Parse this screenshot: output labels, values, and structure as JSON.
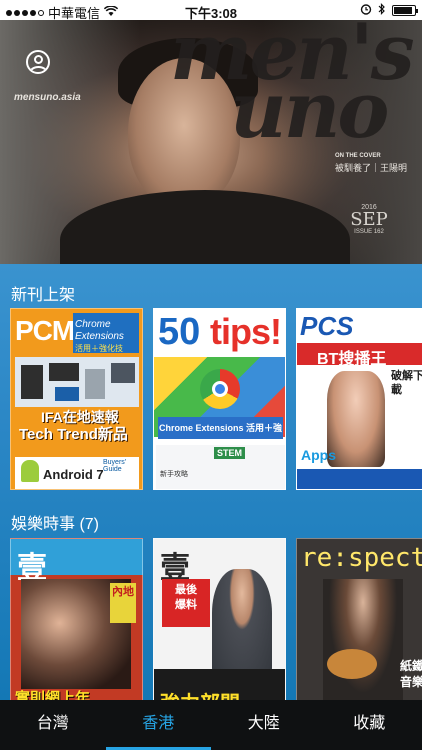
{
  "status_bar": {
    "carrier": "中華電信",
    "time": "下午3:08",
    "battery_level": 0.9
  },
  "hero": {
    "masthead": "men's uno",
    "site": "mensuno.asia",
    "cover_label": "ON THE COVER",
    "cover_name": "被馴養了｜王陽明",
    "issue_year": "2016",
    "issue_month": "SEP",
    "issue_no": "ISSUE 162"
  },
  "sections": [
    {
      "title": "新刊上架",
      "magazines": [
        {
          "name": "PCM",
          "lines": [
            "Chrome",
            "Extensions",
            "活用＋強化技",
            "IFA在地速報",
            "Tech Trend新品",
            "Android 7",
            "Buyers' Guide"
          ]
        },
        {
          "name": "50",
          "lines": [
            "tips!",
            "Chrome Extensions 活用＋強化技",
            "STEM",
            "新手攻略"
          ]
        },
        {
          "name": "PCS",
          "lines": [
            "BT搜播王",
            "破解下載",
            "Apps"
          ]
        }
      ]
    },
    {
      "title": "娛樂時事 (7)",
      "magazines": [
        {
          "name": "壹",
          "lines": [
            "實則網上年",
            "內地"
          ]
        },
        {
          "name": "壹",
          "lines": [
            "最後",
            "爆料",
            "強力部門"
          ]
        },
        {
          "name": "re:spect",
          "lines": [
            "紙鐵",
            "音樂"
          ]
        }
      ]
    }
  ],
  "tabs": [
    "台灣",
    "香港",
    "大陸",
    "收藏"
  ],
  "active_tab": "香港",
  "colors": {
    "accent": "#27a4e3",
    "content_bg_top": "#3a93cf",
    "content_bg_bottom": "#1478b5",
    "tab_bar_bg": "#0f1112"
  }
}
